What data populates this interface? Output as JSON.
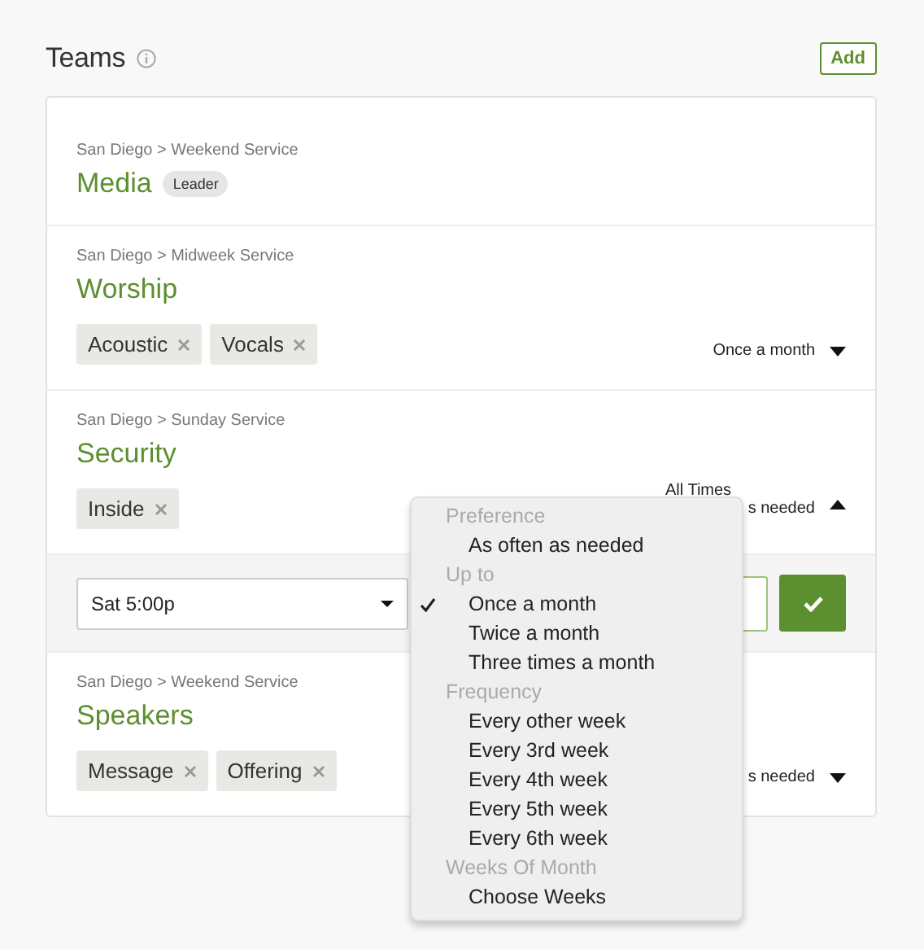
{
  "title": "Teams",
  "add_button": "Add",
  "teams": [
    {
      "path": "San Diego > Weekend Service",
      "name": "Media",
      "badge": "Leader"
    },
    {
      "path": "San Diego > Midweek Service",
      "name": "Worship",
      "tags": [
        "Acoustic",
        "Vocals"
      ],
      "frequency": "Once a month",
      "expanded": false
    },
    {
      "path": "San Diego > Sunday Service",
      "name": "Security",
      "tags": [
        "Inside"
      ],
      "times": "All Times",
      "frequency": "s needed",
      "expanded": true,
      "editor": {
        "time_select": "Sat 5:00p"
      }
    },
    {
      "path": "San Diego > Weekend Service",
      "name": "Speakers",
      "tags": [
        "Message",
        "Offering"
      ],
      "frequency": "s needed",
      "expanded": false
    }
  ],
  "menu": {
    "groups": [
      {
        "label": "Preference",
        "options": [
          {
            "label": "As often as needed",
            "selected": false
          }
        ]
      },
      {
        "label": "Up to",
        "options": [
          {
            "label": "Once a month",
            "selected": true
          },
          {
            "label": "Twice a month",
            "selected": false
          },
          {
            "label": "Three times a month",
            "selected": false
          }
        ]
      },
      {
        "label": "Frequency",
        "options": [
          {
            "label": "Every other week",
            "selected": false
          },
          {
            "label": "Every 3rd week",
            "selected": false
          },
          {
            "label": "Every 4th week",
            "selected": false
          },
          {
            "label": "Every 5th week",
            "selected": false
          },
          {
            "label": "Every 6th week",
            "selected": false
          }
        ]
      },
      {
        "label": "Weeks Of Month",
        "options": [
          {
            "label": "Choose Weeks",
            "selected": false
          }
        ]
      }
    ]
  }
}
